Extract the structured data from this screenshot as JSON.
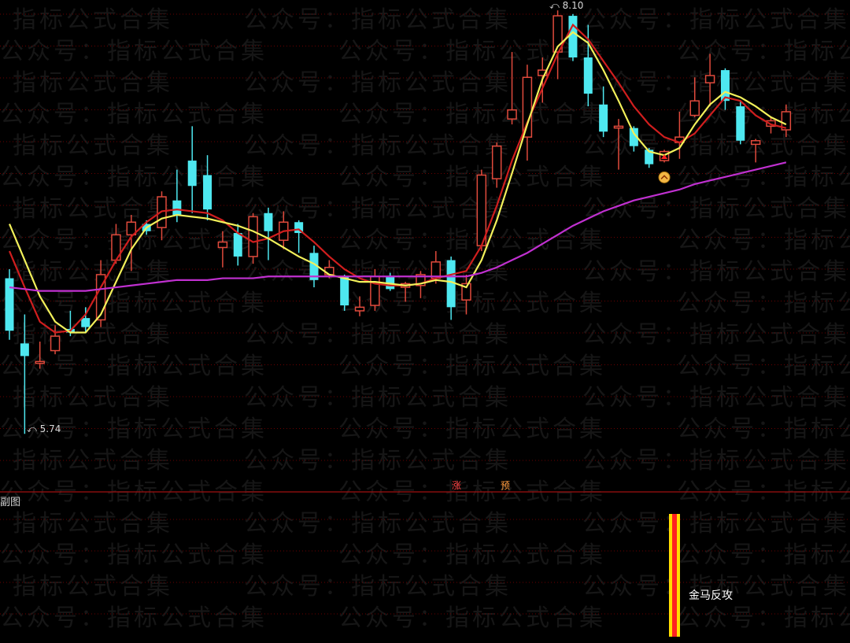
{
  "watermark_text": "公众号：指标公式合集",
  "main_panel": {
    "high_label": "8.10",
    "low_label": "5.74",
    "marker_zhang": "涨",
    "marker_yu": "预"
  },
  "sub_panel": {
    "title": "副图",
    "signal_label": "金马反攻"
  },
  "colors": {
    "background": "#000000",
    "grid": "#6a0000",
    "up_candle": "#e04a3c",
    "down_candle": "#4ee8f0",
    "ma_red": "#d01e1e",
    "ma_yellow": "#f2f05a",
    "ma_magenta": "#c030d0",
    "signal_bar_outer": "#ffdd00",
    "signal_bar_inner": "#ff2020"
  },
  "chart_data": {
    "type": "candlestick",
    "title": "",
    "y_scale": "price",
    "annotations": [
      "8.10",
      "5.74"
    ],
    "candles": [
      {
        "o": 6.6,
        "h": 6.65,
        "l": 6.26,
        "c": 6.31
      },
      {
        "o": 6.24,
        "h": 6.4,
        "l": 5.74,
        "c": 6.17
      },
      {
        "o": 6.13,
        "h": 6.25,
        "l": 6.1,
        "c": 6.14
      },
      {
        "o": 6.2,
        "h": 6.34,
        "l": 6.18,
        "c": 6.28
      },
      {
        "o": 6.32,
        "h": 6.42,
        "l": 6.28,
        "c": 6.3
      },
      {
        "o": 6.38,
        "h": 6.44,
        "l": 6.3,
        "c": 6.33
      },
      {
        "o": 6.37,
        "h": 6.7,
        "l": 6.33,
        "c": 6.62
      },
      {
        "o": 6.7,
        "h": 6.9,
        "l": 6.68,
        "c": 6.84
      },
      {
        "o": 6.84,
        "h": 6.95,
        "l": 6.64,
        "c": 6.91
      },
      {
        "o": 6.9,
        "h": 6.92,
        "l": 6.84,
        "c": 6.86
      },
      {
        "o": 6.88,
        "h": 7.08,
        "l": 6.81,
        "c": 7.05
      },
      {
        "o": 7.03,
        "h": 7.2,
        "l": 6.91,
        "c": 6.95
      },
      {
        "o": 7.25,
        "h": 7.44,
        "l": 6.96,
        "c": 7.11
      },
      {
        "o": 7.17,
        "h": 7.28,
        "l": 6.92,
        "c": 6.98
      },
      {
        "o": 6.77,
        "h": 6.86,
        "l": 6.66,
        "c": 6.8
      },
      {
        "o": 6.85,
        "h": 6.9,
        "l": 6.67,
        "c": 6.72
      },
      {
        "o": 6.72,
        "h": 6.96,
        "l": 6.68,
        "c": 6.94
      },
      {
        "o": 6.96,
        "h": 6.99,
        "l": 6.7,
        "c": 6.86
      },
      {
        "o": 6.81,
        "h": 6.97,
        "l": 6.76,
        "c": 6.91
      },
      {
        "o": 6.91,
        "h": 6.92,
        "l": 6.74,
        "c": 6.85
      },
      {
        "o": 6.74,
        "h": 6.78,
        "l": 6.55,
        "c": 6.59
      },
      {
        "o": 6.62,
        "h": 6.7,
        "l": 6.6,
        "c": 6.66
      },
      {
        "o": 6.61,
        "h": 6.62,
        "l": 6.42,
        "c": 6.45
      },
      {
        "o": 6.42,
        "h": 6.5,
        "l": 6.39,
        "c": 6.44
      },
      {
        "o": 6.45,
        "h": 6.65,
        "l": 6.42,
        "c": 6.61
      },
      {
        "o": 6.61,
        "h": 6.63,
        "l": 6.53,
        "c": 6.54
      },
      {
        "o": 6.55,
        "h": 6.58,
        "l": 6.47,
        "c": 6.57
      },
      {
        "o": 6.56,
        "h": 6.64,
        "l": 6.49,
        "c": 6.62
      },
      {
        "o": 6.6,
        "h": 6.75,
        "l": 6.57,
        "c": 6.69
      },
      {
        "o": 6.7,
        "h": 6.72,
        "l": 6.37,
        "c": 6.44
      },
      {
        "o": 6.48,
        "h": 6.62,
        "l": 6.4,
        "c": 6.57
      },
      {
        "o": 6.78,
        "h": 7.2,
        "l": 6.75,
        "c": 7.17
      },
      {
        "o": 7.15,
        "h": 7.35,
        "l": 7.1,
        "c": 7.33
      },
      {
        "o": 7.48,
        "h": 7.85,
        "l": 7.45,
        "c": 7.53
      },
      {
        "o": 7.38,
        "h": 7.78,
        "l": 7.25,
        "c": 7.71
      },
      {
        "o": 7.72,
        "h": 7.82,
        "l": 7.57,
        "c": 7.75
      },
      {
        "o": 7.85,
        "h": 8.08,
        "l": 7.7,
        "c": 8.05
      },
      {
        "o": 8.05,
        "h": 8.06,
        "l": 7.8,
        "c": 7.82
      },
      {
        "o": 7.82,
        "h": 8.0,
        "l": 7.55,
        "c": 7.62
      },
      {
        "o": 7.56,
        "h": 7.66,
        "l": 7.38,
        "c": 7.41
      },
      {
        "o": 7.43,
        "h": 7.48,
        "l": 7.2,
        "c": 7.44
      },
      {
        "o": 7.43,
        "h": 7.44,
        "l": 7.3,
        "c": 7.33
      },
      {
        "o": 7.31,
        "h": 7.32,
        "l": 7.21,
        "c": 7.23
      },
      {
        "o": 7.25,
        "h": 7.31,
        "l": 7.24,
        "c": 7.3
      },
      {
        "o": 7.35,
        "h": 7.52,
        "l": 7.26,
        "c": 7.38
      },
      {
        "o": 7.5,
        "h": 7.71,
        "l": 7.49,
        "c": 7.58
      },
      {
        "o": 7.68,
        "h": 7.84,
        "l": 7.55,
        "c": 7.72
      },
      {
        "o": 7.75,
        "h": 7.76,
        "l": 7.53,
        "c": 7.58
      },
      {
        "o": 7.55,
        "h": 7.58,
        "l": 7.34,
        "c": 7.36
      },
      {
        "o": 7.34,
        "h": 7.37,
        "l": 7.24,
        "c": 7.36
      },
      {
        "o": 7.44,
        "h": 7.49,
        "l": 7.4,
        "c": 7.47
      },
      {
        "o": 7.42,
        "h": 7.56,
        "l": 7.38,
        "c": 7.52
      }
    ],
    "series": [
      {
        "name": "",
        "color": "#d01e1e",
        "values": [
          6.75,
          6.55,
          6.36,
          6.3,
          6.31,
          6.4,
          6.55,
          6.7,
          6.83,
          6.91,
          6.97,
          6.98,
          6.97,
          6.96,
          6.92,
          6.85,
          6.8,
          6.82,
          6.86,
          6.87,
          6.8,
          6.72,
          6.65,
          6.6,
          6.57,
          6.56,
          6.56,
          6.57,
          6.6,
          6.62,
          6.64,
          6.78,
          7.0,
          7.25,
          7.46,
          7.65,
          7.84,
          8.0,
          7.92,
          7.8,
          7.68,
          7.55,
          7.45,
          7.38,
          7.35,
          7.4,
          7.5,
          7.6,
          7.58,
          7.5,
          7.45,
          7.43
        ]
      },
      {
        "name": "",
        "color": "#f2f05a",
        "values": [
          6.9,
          6.7,
          6.5,
          6.36,
          6.3,
          6.3,
          6.4,
          6.58,
          6.76,
          6.88,
          6.93,
          6.95,
          6.94,
          6.93,
          6.91,
          6.89,
          6.86,
          6.82,
          6.77,
          6.72,
          6.68,
          6.62,
          6.6,
          6.58,
          6.58,
          6.57,
          6.56,
          6.57,
          6.59,
          6.58,
          6.55,
          6.7,
          6.92,
          7.18,
          7.45,
          7.7,
          7.88,
          7.96,
          7.9,
          7.75,
          7.58,
          7.4,
          7.3,
          7.28,
          7.32,
          7.45,
          7.56,
          7.63,
          7.6,
          7.55,
          7.49,
          7.45
        ]
      },
      {
        "name": "",
        "color": "#c030d0",
        "values": [
          6.55,
          6.54,
          6.53,
          6.53,
          6.53,
          6.53,
          6.54,
          6.55,
          6.56,
          6.57,
          6.58,
          6.59,
          6.59,
          6.59,
          6.6,
          6.6,
          6.6,
          6.61,
          6.61,
          6.61,
          6.61,
          6.61,
          6.61,
          6.61,
          6.61,
          6.61,
          6.61,
          6.61,
          6.61,
          6.61,
          6.61,
          6.63,
          6.66,
          6.7,
          6.74,
          6.79,
          6.84,
          6.89,
          6.93,
          6.97,
          7.0,
          7.03,
          7.05,
          7.07,
          7.09,
          7.12,
          7.14,
          7.16,
          7.18,
          7.2,
          7.22,
          7.24
        ]
      }
    ],
    "signals": [
      {
        "label": "涨",
        "index": 29
      },
      {
        "label": "预",
        "index": 32
      },
      {
        "label": "金马反攻",
        "index": 43
      }
    ]
  }
}
